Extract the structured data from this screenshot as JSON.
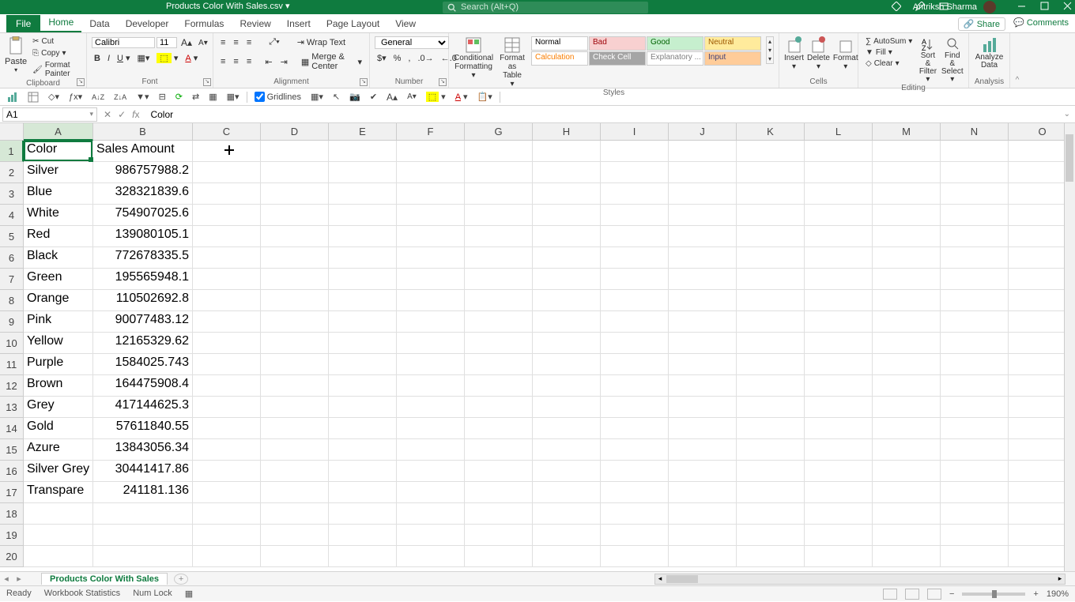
{
  "titlebar": {
    "document_title": "Products Color With Sales.csv",
    "saved_indicator": "▾",
    "search_placeholder": "Search (Alt+Q)",
    "user_name": "Antriksh Sharma"
  },
  "menu": {
    "file": "File",
    "tabs": [
      "Home",
      "Data",
      "Developer",
      "Formulas",
      "Review",
      "Insert",
      "Page Layout",
      "View"
    ],
    "active_tab": "Home",
    "share": "Share",
    "comments": "Comments"
  },
  "ribbon": {
    "clipboard": {
      "paste": "Paste",
      "cut": "Cut",
      "copy": "Copy",
      "format_painter": "Format Painter",
      "label": "Clipboard"
    },
    "font": {
      "name": "Calibri",
      "size": "11",
      "label": "Font"
    },
    "alignment": {
      "wrap": "Wrap Text",
      "merge": "Merge & Center",
      "label": "Alignment"
    },
    "number": {
      "format": "General",
      "label": "Number"
    },
    "styles": {
      "conditional": "Conditional Formatting",
      "format_table": "Format as Table",
      "gallery": [
        {
          "t": "Normal",
          "bg": "#fff",
          "c": "#000"
        },
        {
          "t": "Bad",
          "bg": "#f8d0d0",
          "c": "#9c0006"
        },
        {
          "t": "Good",
          "bg": "#c6efce",
          "c": "#006100"
        },
        {
          "t": "Neutral",
          "bg": "#ffeb9c",
          "c": "#9c5700"
        },
        {
          "t": "Calculation",
          "bg": "#fff",
          "c": "#fa7d00"
        },
        {
          "t": "Check Cell",
          "bg": "#a5a5a5",
          "c": "#fff"
        },
        {
          "t": "Explanatory ...",
          "bg": "#fff",
          "c": "#7f7f7f"
        },
        {
          "t": "Input",
          "bg": "#ffcc99",
          "c": "#3f3f76"
        }
      ],
      "label": "Styles"
    },
    "cells": {
      "insert": "Insert",
      "delete": "Delete",
      "format": "Format",
      "label": "Cells"
    },
    "editing": {
      "autosum": "AutoSum",
      "fill": "Fill",
      "clear": "Clear",
      "sort": "Sort & Filter",
      "find": "Find & Select",
      "label": "Editing"
    },
    "analysis": {
      "analyze": "Analyze Data",
      "label": "Analysis"
    }
  },
  "qat": {
    "gridlines": "Gridlines"
  },
  "name_box": "A1",
  "formula_bar": "Color",
  "grid": {
    "col_widths": {
      "A": 88,
      "B": 126,
      "other": 86
    },
    "columns": [
      "A",
      "B",
      "C",
      "D",
      "E",
      "F",
      "G",
      "H",
      "I",
      "J",
      "K",
      "L",
      "M",
      "N",
      "O"
    ],
    "selected_cell": "A1",
    "rows": [
      [
        "Color",
        "Sales Amount"
      ],
      [
        "Silver",
        "986757988.2"
      ],
      [
        "Blue",
        "328321839.6"
      ],
      [
        "White",
        "754907025.6"
      ],
      [
        "Red",
        "139080105.1"
      ],
      [
        "Black",
        "772678335.5"
      ],
      [
        "Green",
        "195565948.1"
      ],
      [
        "Orange",
        "110502692.8"
      ],
      [
        "Pink",
        "90077483.12"
      ],
      [
        "Yellow",
        "12165329.62"
      ],
      [
        "Purple",
        "1584025.743"
      ],
      [
        "Brown",
        "164475908.4"
      ],
      [
        "Grey",
        "417144625.3"
      ],
      [
        "Gold",
        "57611840.55"
      ],
      [
        "Azure",
        "13843056.34"
      ],
      [
        "Silver Grey",
        "30441417.86"
      ],
      [
        "Transpare",
        "241181.136"
      ]
    ],
    "visible_rows": 20
  },
  "sheet_tab": "Products Color With Sales",
  "statusbar": {
    "ready": "Ready",
    "stats": "Workbook Statistics",
    "numlock": "Num Lock",
    "zoom": "190%"
  }
}
